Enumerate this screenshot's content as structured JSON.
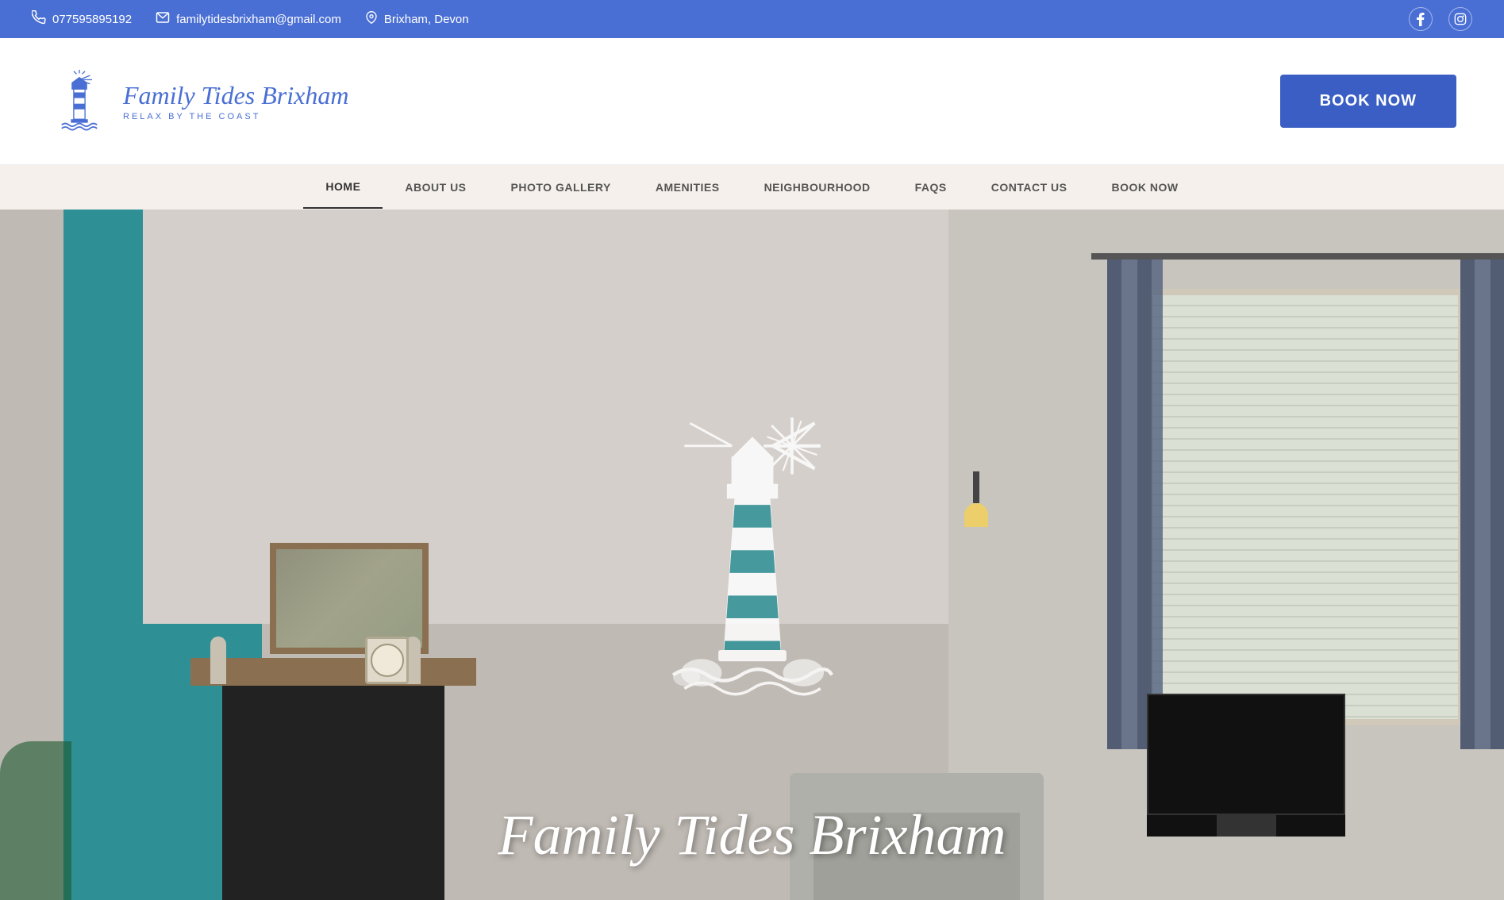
{
  "topbar": {
    "phone": "077595895192",
    "email": "familytidesbrixham@gmail.com",
    "location": "Brixham, Devon",
    "phone_icon": "phone-icon",
    "email_icon": "email-icon",
    "location_icon": "location-icon",
    "facebook_icon": "facebook-icon",
    "instagram_icon": "instagram-icon"
  },
  "header": {
    "logo_title": "Family Tides Brixham",
    "logo_subtitle": "RELAX BY THE COAST",
    "book_now": "BOOK NOW"
  },
  "nav": {
    "items": [
      {
        "label": "HOME",
        "active": true
      },
      {
        "label": "ABOUT US",
        "active": false
      },
      {
        "label": "PHOTO GALLERY",
        "active": false
      },
      {
        "label": "AMENITIES",
        "active": false
      },
      {
        "label": "NEIGHBOURHOOD",
        "active": false
      },
      {
        "label": "FAQS",
        "active": false
      },
      {
        "label": "CONTACT US",
        "active": false
      },
      {
        "label": "BOOK NOW",
        "active": false
      }
    ]
  },
  "hero": {
    "title": "Family Tides Brixham",
    "bg_color": "#8aacb0"
  },
  "colors": {
    "top_bar_blue": "#4a6fd4",
    "book_btn_blue": "#3a5ec4",
    "nav_bg": "#f5f0eb",
    "teal": "#2e9095"
  }
}
